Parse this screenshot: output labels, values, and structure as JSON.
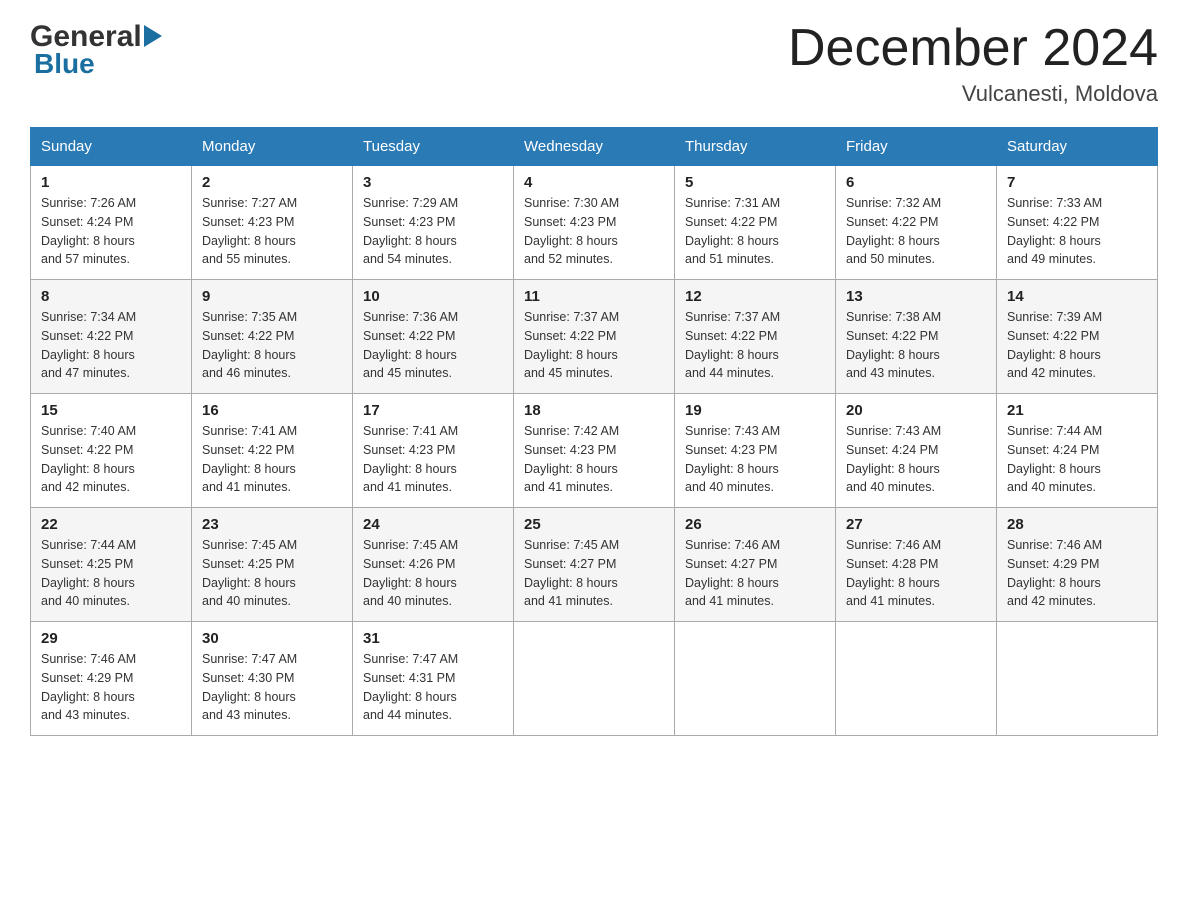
{
  "header": {
    "logo": {
      "general": "General",
      "blue": "Blue"
    },
    "title": "December 2024",
    "location": "Vulcanesti, Moldova"
  },
  "weekdays": [
    "Sunday",
    "Monday",
    "Tuesday",
    "Wednesday",
    "Thursday",
    "Friday",
    "Saturday"
  ],
  "weeks": [
    [
      {
        "day": "1",
        "sunrise": "7:26 AM",
        "sunset": "4:24 PM",
        "daylight": "8 hours and 57 minutes."
      },
      {
        "day": "2",
        "sunrise": "7:27 AM",
        "sunset": "4:23 PM",
        "daylight": "8 hours and 55 minutes."
      },
      {
        "day": "3",
        "sunrise": "7:29 AM",
        "sunset": "4:23 PM",
        "daylight": "8 hours and 54 minutes."
      },
      {
        "day": "4",
        "sunrise": "7:30 AM",
        "sunset": "4:23 PM",
        "daylight": "8 hours and 52 minutes."
      },
      {
        "day": "5",
        "sunrise": "7:31 AM",
        "sunset": "4:22 PM",
        "daylight": "8 hours and 51 minutes."
      },
      {
        "day": "6",
        "sunrise": "7:32 AM",
        "sunset": "4:22 PM",
        "daylight": "8 hours and 50 minutes."
      },
      {
        "day": "7",
        "sunrise": "7:33 AM",
        "sunset": "4:22 PM",
        "daylight": "8 hours and 49 minutes."
      }
    ],
    [
      {
        "day": "8",
        "sunrise": "7:34 AM",
        "sunset": "4:22 PM",
        "daylight": "8 hours and 47 minutes."
      },
      {
        "day": "9",
        "sunrise": "7:35 AM",
        "sunset": "4:22 PM",
        "daylight": "8 hours and 46 minutes."
      },
      {
        "day": "10",
        "sunrise": "7:36 AM",
        "sunset": "4:22 PM",
        "daylight": "8 hours and 45 minutes."
      },
      {
        "day": "11",
        "sunrise": "7:37 AM",
        "sunset": "4:22 PM",
        "daylight": "8 hours and 45 minutes."
      },
      {
        "day": "12",
        "sunrise": "7:37 AM",
        "sunset": "4:22 PM",
        "daylight": "8 hours and 44 minutes."
      },
      {
        "day": "13",
        "sunrise": "7:38 AM",
        "sunset": "4:22 PM",
        "daylight": "8 hours and 43 minutes."
      },
      {
        "day": "14",
        "sunrise": "7:39 AM",
        "sunset": "4:22 PM",
        "daylight": "8 hours and 42 minutes."
      }
    ],
    [
      {
        "day": "15",
        "sunrise": "7:40 AM",
        "sunset": "4:22 PM",
        "daylight": "8 hours and 42 minutes."
      },
      {
        "day": "16",
        "sunrise": "7:41 AM",
        "sunset": "4:22 PM",
        "daylight": "8 hours and 41 minutes."
      },
      {
        "day": "17",
        "sunrise": "7:41 AM",
        "sunset": "4:23 PM",
        "daylight": "8 hours and 41 minutes."
      },
      {
        "day": "18",
        "sunrise": "7:42 AM",
        "sunset": "4:23 PM",
        "daylight": "8 hours and 41 minutes."
      },
      {
        "day": "19",
        "sunrise": "7:43 AM",
        "sunset": "4:23 PM",
        "daylight": "8 hours and 40 minutes."
      },
      {
        "day": "20",
        "sunrise": "7:43 AM",
        "sunset": "4:24 PM",
        "daylight": "8 hours and 40 minutes."
      },
      {
        "day": "21",
        "sunrise": "7:44 AM",
        "sunset": "4:24 PM",
        "daylight": "8 hours and 40 minutes."
      }
    ],
    [
      {
        "day": "22",
        "sunrise": "7:44 AM",
        "sunset": "4:25 PM",
        "daylight": "8 hours and 40 minutes."
      },
      {
        "day": "23",
        "sunrise": "7:45 AM",
        "sunset": "4:25 PM",
        "daylight": "8 hours and 40 minutes."
      },
      {
        "day": "24",
        "sunrise": "7:45 AM",
        "sunset": "4:26 PM",
        "daylight": "8 hours and 40 minutes."
      },
      {
        "day": "25",
        "sunrise": "7:45 AM",
        "sunset": "4:27 PM",
        "daylight": "8 hours and 41 minutes."
      },
      {
        "day": "26",
        "sunrise": "7:46 AM",
        "sunset": "4:27 PM",
        "daylight": "8 hours and 41 minutes."
      },
      {
        "day": "27",
        "sunrise": "7:46 AM",
        "sunset": "4:28 PM",
        "daylight": "8 hours and 41 minutes."
      },
      {
        "day": "28",
        "sunrise": "7:46 AM",
        "sunset": "4:29 PM",
        "daylight": "8 hours and 42 minutes."
      }
    ],
    [
      {
        "day": "29",
        "sunrise": "7:46 AM",
        "sunset": "4:29 PM",
        "daylight": "8 hours and 43 minutes."
      },
      {
        "day": "30",
        "sunrise": "7:47 AM",
        "sunset": "4:30 PM",
        "daylight": "8 hours and 43 minutes."
      },
      {
        "day": "31",
        "sunrise": "7:47 AM",
        "sunset": "4:31 PM",
        "daylight": "8 hours and 44 minutes."
      },
      null,
      null,
      null,
      null
    ]
  ],
  "labels": {
    "sunrise": "Sunrise:",
    "sunset": "Sunset:",
    "daylight": "Daylight:"
  }
}
